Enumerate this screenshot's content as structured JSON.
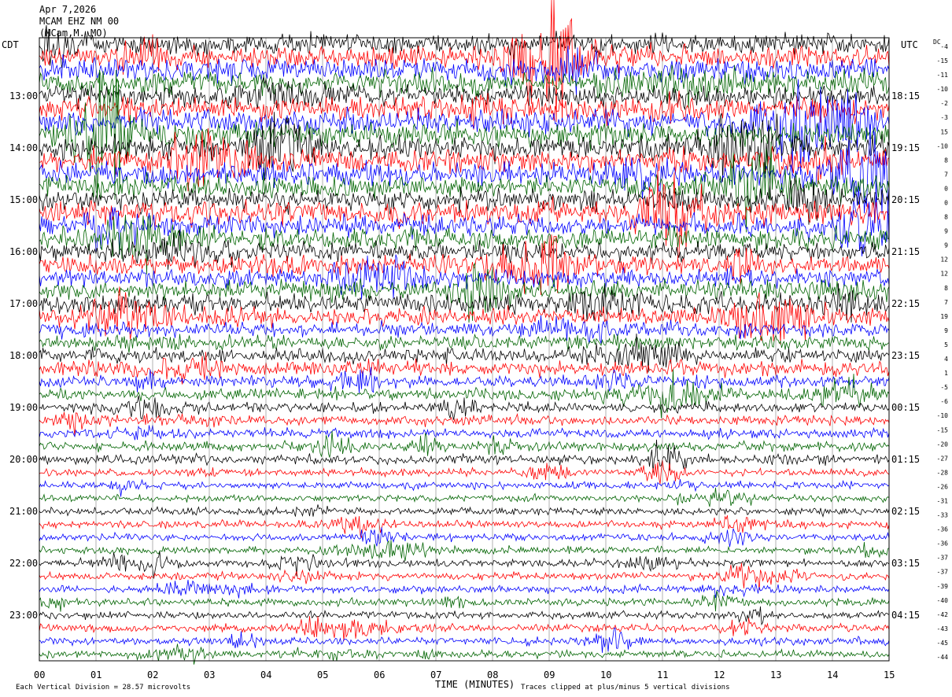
{
  "header": {
    "line1": "Apr 7,2026",
    "line2": "MCAM EHZ NM 00",
    "line3": "(MCam,M. MO)"
  },
  "left_tz": "CDT",
  "right_tz": "UTC",
  "dc_header": "DC",
  "x_axis_label": "TIME (MINUTES)",
  "footer": {
    "left": "Each Vertical Division =   28.57 microvolts",
    "right": "Traces clipped at plus/minus 5 vertical divisions"
  },
  "colors": {
    "trace_cycle": [
      "#000000",
      "#ff0000",
      "#0000ff",
      "#006400"
    ],
    "grid": "#7f7f7f"
  },
  "chart_data": {
    "type": "line",
    "description_of_display": "helicorder",
    "xlim": [
      0,
      15
    ],
    "x_ticks": [
      "00",
      "01",
      "02",
      "03",
      "04",
      "05",
      "06",
      "07",
      "08",
      "09",
      "10",
      "11",
      "12",
      "13",
      "14",
      "15"
    ],
    "rows": 48,
    "left_hour_labels": [
      "13:00",
      "14:00",
      "15:00",
      "16:00",
      "17:00",
      "18:00",
      "19:00",
      "20:00",
      "21:00",
      "22:00",
      "23:00"
    ],
    "right_hour_labels": [
      "18:15",
      "19:15",
      "20:15",
      "21:15",
      "22:15",
      "23:15",
      "00:15",
      "01:15",
      "02:15",
      "03:15",
      "04:15"
    ],
    "dc_offsets": [
      -4,
      -15,
      -11,
      -10,
      -2,
      -3,
      15,
      -10,
      8,
      7,
      0,
      0,
      8,
      9,
      9,
      12,
      12,
      8,
      7,
      19,
      9,
      5,
      4,
      1,
      -5,
      -6,
      -10,
      -15,
      -20,
      -27,
      -28,
      -26,
      -31,
      -33,
      -36,
      -36,
      -37,
      -37,
      -39,
      -40,
      -42,
      -43,
      -45,
      -44
    ],
    "amplitude_level": [
      9,
      9,
      10,
      10,
      9,
      10,
      10,
      10,
      10,
      10,
      10,
      10,
      9,
      10,
      9,
      9,
      8,
      8,
      8,
      8,
      8,
      7,
      6,
      6,
      6,
      6,
      5,
      5,
      4,
      4,
      4,
      4,
      4,
      3,
      3,
      3,
      3,
      3,
      3,
      3,
      3,
      3,
      3,
      3,
      3,
      3,
      3,
      3
    ]
  }
}
